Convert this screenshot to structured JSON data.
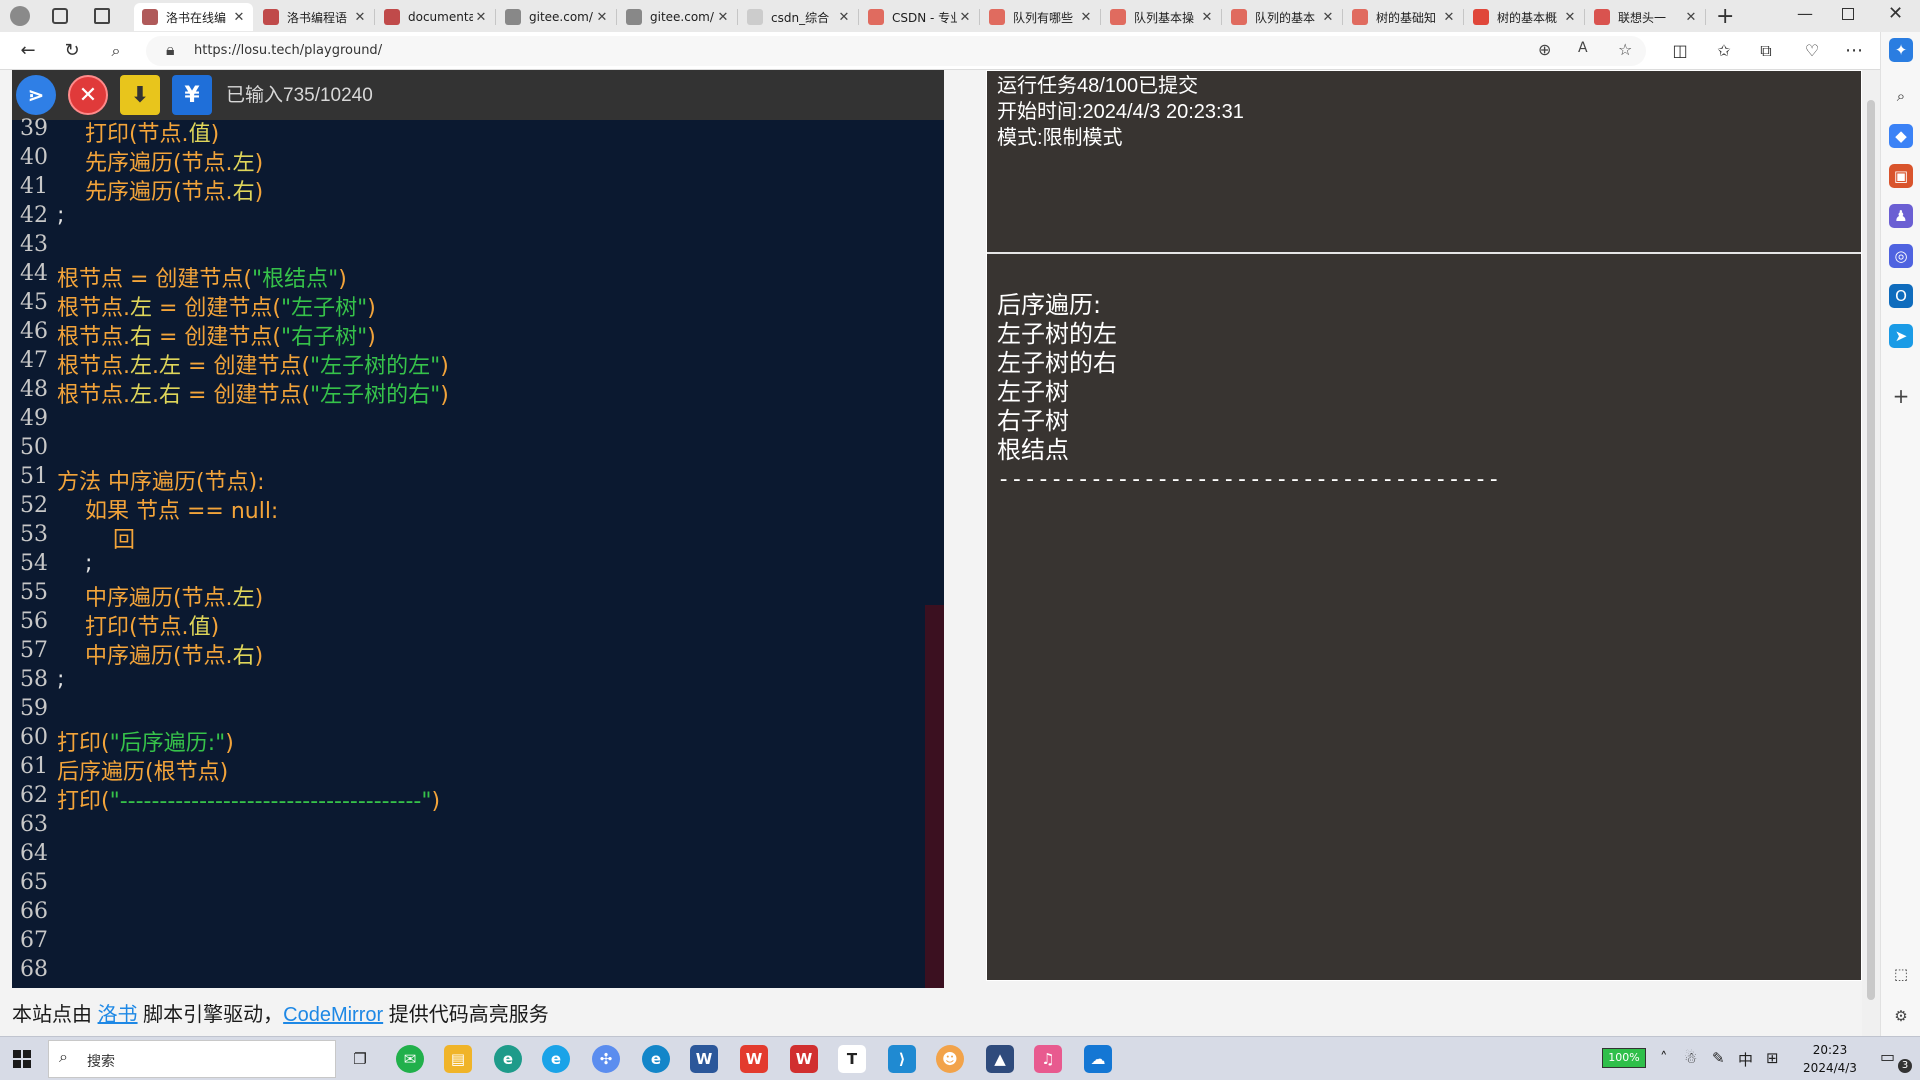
{
  "browser": {
    "tabs": [
      {
        "label": "洛书在线编",
        "active": true,
        "color": "#b05a5a"
      },
      {
        "label": "洛书编程语",
        "active": false,
        "color": "#c04a4a"
      },
      {
        "label": "documentati",
        "active": false,
        "color": "#c04a4a"
      },
      {
        "label": "gitee.com/",
        "active": false,
        "color": "#888888"
      },
      {
        "label": "gitee.com/",
        "active": false,
        "color": "#888888"
      },
      {
        "label": "csdn_综合",
        "active": false,
        "color": "#cccccc"
      },
      {
        "label": "CSDN - 专业",
        "active": false,
        "color": "#e06b5f"
      },
      {
        "label": "队列有哪些",
        "active": false,
        "color": "#e06b5f"
      },
      {
        "label": "队列基本操",
        "active": false,
        "color": "#e06b5f"
      },
      {
        "label": "队列的基本",
        "active": false,
        "color": "#e06b5f"
      },
      {
        "label": "树的基础知",
        "active": false,
        "color": "#e06b5f"
      },
      {
        "label": "树的基本概",
        "active": false,
        "color": "#e0473a"
      },
      {
        "label": "联想头一",
        "active": false,
        "color": "#d9534f"
      }
    ],
    "url": "https://losu.tech/playground/"
  },
  "editor": {
    "typed_count": "已输入735/10240",
    "lines": [
      {
        "n": "39",
        "parts": [
          {
            "t": "    打印(节点.",
            "c": ""
          },
          {
            "t": "值",
            "c": "n"
          },
          {
            "t": ")",
            "c": ""
          }
        ]
      },
      {
        "n": "40",
        "parts": [
          {
            "t": "    先序遍历(节点.",
            "c": ""
          },
          {
            "t": "左",
            "c": "n"
          },
          {
            "t": ")",
            "c": ""
          }
        ]
      },
      {
        "n": "41",
        "parts": [
          {
            "t": "    先序遍历(节点.",
            "c": ""
          },
          {
            "t": "右",
            "c": "n"
          },
          {
            "t": ")",
            "c": ""
          }
        ]
      },
      {
        "n": "42",
        "parts": [
          {
            "t": ";",
            "c": "p"
          }
        ]
      },
      {
        "n": "43",
        "parts": []
      },
      {
        "n": "44",
        "parts": [
          {
            "t": "根节点 = 创建节点(",
            "c": ""
          },
          {
            "t": "\"根结点\"",
            "c": "s"
          },
          {
            "t": ")",
            "c": ""
          }
        ]
      },
      {
        "n": "45",
        "parts": [
          {
            "t": "根节点.",
            "c": ""
          },
          {
            "t": "左",
            "c": "n"
          },
          {
            "t": " = 创建节点(",
            "c": ""
          },
          {
            "t": "\"左子树\"",
            "c": "s"
          },
          {
            "t": ")",
            "c": ""
          }
        ]
      },
      {
        "n": "46",
        "parts": [
          {
            "t": "根节点.",
            "c": ""
          },
          {
            "t": "右",
            "c": "n"
          },
          {
            "t": " = 创建节点(",
            "c": ""
          },
          {
            "t": "\"右子树\"",
            "c": "s"
          },
          {
            "t": ")",
            "c": ""
          }
        ]
      },
      {
        "n": "47",
        "parts": [
          {
            "t": "根节点.",
            "c": ""
          },
          {
            "t": "左",
            "c": "n"
          },
          {
            "t": ".",
            "c": ""
          },
          {
            "t": "左",
            "c": "n"
          },
          {
            "t": " = 创建节点(",
            "c": ""
          },
          {
            "t": "\"左子树的左\"",
            "c": "s"
          },
          {
            "t": ")",
            "c": ""
          }
        ]
      },
      {
        "n": "48",
        "parts": [
          {
            "t": "根节点.",
            "c": ""
          },
          {
            "t": "左",
            "c": "n"
          },
          {
            "t": ".",
            "c": ""
          },
          {
            "t": "右",
            "c": "n"
          },
          {
            "t": " = 创建节点(",
            "c": ""
          },
          {
            "t": "\"左子树的右\"",
            "c": "s"
          },
          {
            "t": ")",
            "c": ""
          }
        ]
      },
      {
        "n": "49",
        "parts": []
      },
      {
        "n": "50",
        "parts": []
      },
      {
        "n": "51",
        "parts": [
          {
            "t": "方法 中序遍历(节点):",
            "c": ""
          }
        ]
      },
      {
        "n": "52",
        "parts": [
          {
            "t": "    如果 节点 == null:",
            "c": ""
          }
        ]
      },
      {
        "n": "53",
        "parts": [
          {
            "t": "        回",
            "c": ""
          }
        ]
      },
      {
        "n": "54",
        "parts": [
          {
            "t": "    ;",
            "c": "p"
          }
        ]
      },
      {
        "n": "55",
        "parts": [
          {
            "t": "    中序遍历(节点.",
            "c": ""
          },
          {
            "t": "左",
            "c": "n"
          },
          {
            "t": ")",
            "c": ""
          }
        ]
      },
      {
        "n": "56",
        "parts": [
          {
            "t": "    打印(节点.",
            "c": ""
          },
          {
            "t": "值",
            "c": "n"
          },
          {
            "t": ")",
            "c": ""
          }
        ]
      },
      {
        "n": "57",
        "parts": [
          {
            "t": "    中序遍历(节点.",
            "c": ""
          },
          {
            "t": "右",
            "c": "n"
          },
          {
            "t": ")",
            "c": ""
          }
        ]
      },
      {
        "n": "58",
        "parts": [
          {
            "t": ";",
            "c": "p"
          }
        ]
      },
      {
        "n": "59",
        "parts": []
      },
      {
        "n": "60",
        "parts": [
          {
            "t": "打印(",
            "c": ""
          },
          {
            "t": "\"后序遍历:\"",
            "c": "s"
          },
          {
            "t": ")",
            "c": ""
          }
        ]
      },
      {
        "n": "61",
        "parts": [
          {
            "t": "后序遍历(根节点)",
            "c": ""
          }
        ]
      },
      {
        "n": "62",
        "parts": [
          {
            "t": "打印(",
            "c": ""
          },
          {
            "t": "\"--------------------------------------\"",
            "c": "s"
          },
          {
            "t": ")",
            "c": ""
          }
        ]
      },
      {
        "n": "63",
        "parts": []
      },
      {
        "n": "64",
        "parts": []
      },
      {
        "n": "65",
        "parts": []
      },
      {
        "n": "66",
        "parts": []
      },
      {
        "n": "67",
        "parts": []
      },
      {
        "n": "68",
        "parts": []
      }
    ]
  },
  "footer": {
    "prefix": "本站点由 ",
    "link1": "洛书",
    "middle": " 脚本引擎驱动，",
    "link2": "CodeMirror",
    "suffix": " 提供代码高亮服务"
  },
  "output": {
    "task": "运行任务48/100已提交",
    "start_time": "开始时间:2024/4/3 20:23:31",
    "mode": "模式:限制模式",
    "console_lines": [
      "后序遍历:",
      "左子树的左",
      "左子树的右",
      "左子树",
      "右子树",
      "根结点"
    ],
    "console_dash": "--------------------------------------"
  },
  "taskbar": {
    "search_placeholder": "搜索",
    "battery": "100%",
    "ime": "中",
    "time": "20:23",
    "date": "2024/4/3",
    "notifications": "3"
  }
}
